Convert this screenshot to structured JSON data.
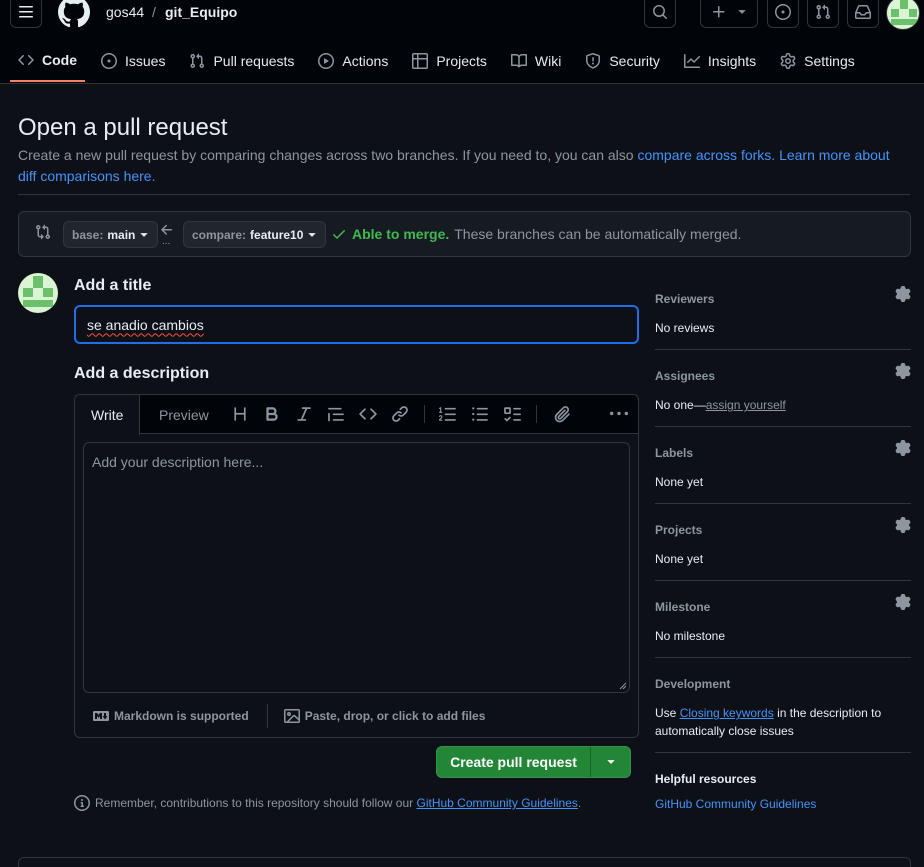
{
  "header": {
    "owner": "gos44",
    "separator": "/",
    "repo": "git_Equipo"
  },
  "tabs": [
    {
      "label": "Code"
    },
    {
      "label": "Issues"
    },
    {
      "label": "Pull requests"
    },
    {
      "label": "Actions"
    },
    {
      "label": "Projects"
    },
    {
      "label": "Wiki"
    },
    {
      "label": "Security"
    },
    {
      "label": "Insights"
    },
    {
      "label": "Settings"
    }
  ],
  "page": {
    "title": "Open a pull request",
    "subtitle_text": "Create a new pull request by comparing changes across two branches. If you need to, you can also ",
    "compare_forks_link": "compare across forks.",
    "learn_more_link": "Learn more about diff comparisons here."
  },
  "range": {
    "base_label": "base:",
    "base_value": "main",
    "compare_label": "compare:",
    "compare_value": "feature10",
    "merge_status": "Able to merge.",
    "merge_detail": "These branches can be automatically merged."
  },
  "form": {
    "title_label": "Add a title",
    "title_value": "se anadio cambios",
    "description_label": "Add a description",
    "write_tab": "Write",
    "preview_tab": "Preview",
    "description_placeholder": "Add your description here...",
    "markdown_note": "Markdown is supported",
    "attach_note": "Paste, drop, or click to add files",
    "create_button": "Create pull request",
    "reminder_text": "Remember, contributions to this repository should follow our ",
    "guidelines_link": "GitHub Community Guidelines",
    "reminder_end": "."
  },
  "sidebar": {
    "reviewers": {
      "title": "Reviewers",
      "value": "No reviews"
    },
    "assignees": {
      "title": "Assignees",
      "value": "No one—",
      "link": "assign yourself"
    },
    "labels": {
      "title": "Labels",
      "value": "None yet"
    },
    "projects": {
      "title": "Projects",
      "value": "None yet"
    },
    "milestone": {
      "title": "Milestone",
      "value": "No milestone"
    },
    "development": {
      "title": "Development",
      "pre": "Use ",
      "link": "Closing keywords",
      "post": " in the description to automatically close issues"
    },
    "helpful": {
      "title": "Helpful resources",
      "link": "GitHub Community Guidelines"
    }
  },
  "colors": {
    "accent_blue": "#4493f8",
    "merge_green": "#3fb950",
    "button_green": "#238636",
    "tab_underline": "#f78166"
  }
}
